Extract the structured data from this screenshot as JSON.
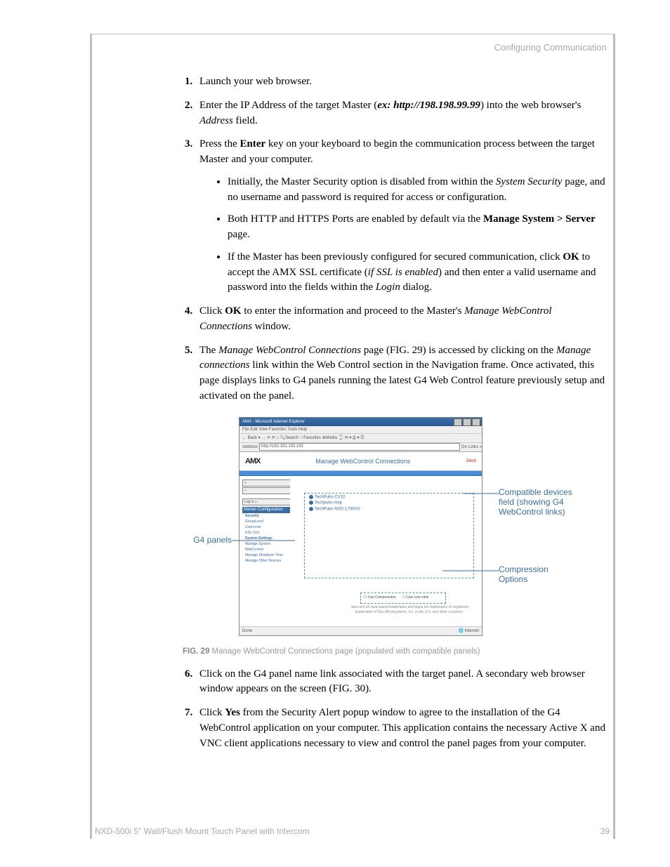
{
  "running_header": "Configuring Communication",
  "steps": {
    "s1": "Launch your web browser.",
    "s2_a": "Enter the IP Address of the target Master (",
    "s2_ex": "ex: http://198.198.99.99",
    "s2_b": ") into the web browser's ",
    "s2_addr": "Address",
    "s2_c": " field.",
    "s3_a": "Press the ",
    "s3_enter": "Enter",
    "s3_b": " key on your keyboard to begin the communication process between the target Master and your computer.",
    "s3_bullets": {
      "b1_a": "Initially, the Master Security option is disabled from within the ",
      "b1_i": "System Security",
      "b1_b": " page, and no username and password is required for access or configuration.",
      "b2_a": "Both HTTP and HTTPS Ports are enabled by default via the ",
      "b2_b": "Manage System > Server",
      "b2_c": " page.",
      "b3_a": "If the Master has been previously configured for secured communication, click ",
      "b3_ok": "OK",
      "b3_b": " to accept the AMX SSL certificate (",
      "b3_i": "if SSL is enabled",
      "b3_c": ") and then enter a valid username and password into the fields within the ",
      "b3_login": "Login",
      "b3_d": " dialog."
    },
    "s4_a": "Click ",
    "s4_ok": "OK",
    "s4_b": " to enter the information and proceed to the Master's ",
    "s4_i": "Manage WebControl Connections",
    "s4_c": " window.",
    "s5_a": "The ",
    "s5_i1": "Manage WebControl Connections",
    "s5_b": " page (FIG. 29) is accessed by clicking on the ",
    "s5_i2": "Manage connections",
    "s5_c": " link within the Web Control section in the Navigation frame. Once activated, this page displays links to G4 panels running the latest G4 Web Control feature previously setup and activated on the panel.",
    "s6_a": "Click on the G4 panel name link associated with the target panel. A secondary web browser window appears on the screen (FIG. 30).",
    "s7_a": "Click ",
    "s7_yes": "Yes",
    "s7_b": " from the Security Alert popup window to agree to the installation of the G4 WebControl application on your computer. This application contains the necessary Active X and VNC client applications necessary to view and control the panel pages from your computer."
  },
  "figure": {
    "browser_title": "AMX - Microsoft Internet Explorer",
    "menubar": "File   Edit   View   Favorites   Tools   Help",
    "toolbar": "← Back  ▾  →  ✕  ⟳  ⌂  🔍Search  ☆Favorites  ⊕Media  ⌚  ✉  ▾  ⎙  ▾  ☰",
    "address_label": "Address",
    "address_value": "http://192.192.192.192",
    "go": "Go",
    "links": "Links »",
    "amx_logo": "AMX",
    "page_title": "Manage WebControl Connections",
    "java": "Java",
    "sidebar": {
      "login": "Log in »",
      "nav_header": "Master Configuration Navigation",
      "sec": "Security",
      "sec_items": [
        "GroupLevel",
        "UserLevel",
        "SSL Cert"
      ],
      "sys": "System Settings",
      "sys_items": [
        "Manage System",
        "WebControl",
        "Manage Shutdown Time",
        "Manage Other Devices"
      ]
    },
    "devices": [
      "TechPubs-CV10",
      "Techpubs-mvp",
      "TechPubs-NXD-1700VG"
    ],
    "compression": {
      "c1": "Use Compression",
      "c2": "Use Low color"
    },
    "fineprint": "Java and all Java based trademarks and logos are trademarks or registered trademarks of Sun Microsystems, Inc. in the U.S. and other countries.",
    "status_left": "Done",
    "status_right": "Internet",
    "caption_bold": "FIG. 29",
    "caption_text": "  Manage WebControl Connections page (populated with compatible panels)",
    "callouts": {
      "g4": "G4 panels",
      "compat": "Compatible devices field (showing G4 WebControl links)",
      "comp": "Compression Options"
    }
  },
  "footer": {
    "left": "NXD-500i 5\" Wall/Flush Mount Touch Panel with Intercom",
    "right": "39"
  }
}
